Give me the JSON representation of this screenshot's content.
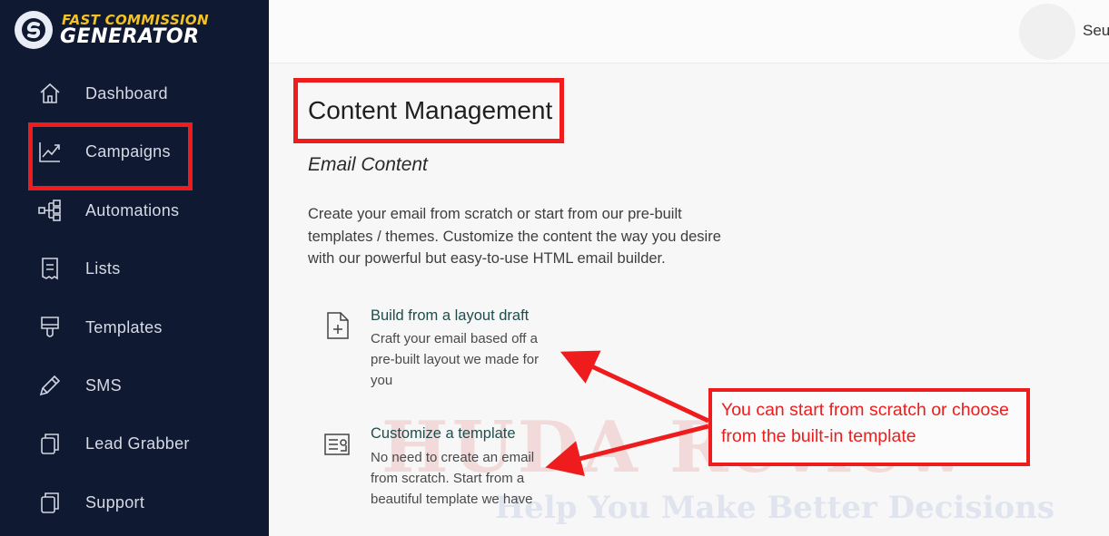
{
  "brand": {
    "line1": "FAST COMMISSION",
    "line2": "GENERATOR"
  },
  "sidebar": {
    "items": [
      {
        "label": "Dashboard",
        "icon": "home-icon"
      },
      {
        "label": "Campaigns",
        "icon": "trend-chart-icon"
      },
      {
        "label": "Automations",
        "icon": "flow-icon"
      },
      {
        "label": "Lists",
        "icon": "list-icon"
      },
      {
        "label": "Templates",
        "icon": "brush-icon"
      },
      {
        "label": "SMS",
        "icon": "pencil-icon"
      },
      {
        "label": "Lead Grabber",
        "icon": "copy-icon"
      },
      {
        "label": "Support",
        "icon": "copy-icon"
      }
    ]
  },
  "header": {
    "user_name": "Seu"
  },
  "main": {
    "title": "Content Management",
    "section_title": "Email Content",
    "description": "Create your email from scratch or start from our pre-built templates / themes. Customize the content the way you desire with our powerful but easy-to-use HTML email builder.",
    "options": [
      {
        "title": "Build from a layout draft",
        "description": "Craft your email based off a pre-built layout we made for you",
        "icon": "file-plus-icon"
      },
      {
        "title": "Customize a template",
        "description": "No need to create an email from scratch. Start from a beautiful template we have",
        "icon": "template-icon"
      }
    ]
  },
  "annotation": {
    "callout": "You can start from scratch or choose from the built-in template"
  },
  "watermark": {
    "line1": "HUDA Review",
    "line2": "Help You Make Better Decisions"
  },
  "colors": {
    "sidebar_bg": "#0f1932",
    "accent_red": "#ee1c1c",
    "brand_yellow": "#f3c224",
    "option_title": "#1f4d4d"
  }
}
